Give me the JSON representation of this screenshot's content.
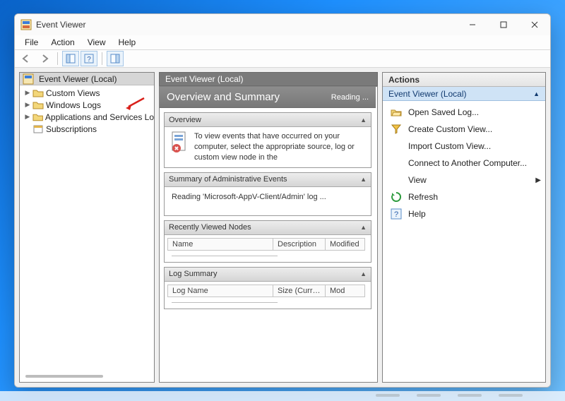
{
  "window": {
    "title": "Event Viewer"
  },
  "menu": {
    "file": "File",
    "action": "Action",
    "view": "View",
    "help": "Help"
  },
  "tree": {
    "root": "Event Viewer (Local)",
    "items": [
      {
        "label": "Custom Views",
        "expandable": true
      },
      {
        "label": "Windows Logs",
        "expandable": true,
        "arrow": true
      },
      {
        "label": "Applications and Services Lo",
        "expandable": true
      },
      {
        "label": "Subscriptions",
        "expandable": false
      }
    ]
  },
  "center": {
    "header": "Event Viewer (Local)",
    "title": "Overview and Summary",
    "reading": "Reading ...",
    "overview": {
      "label": "Overview",
      "text": "To view events that have occurred on your computer, select the appropriate source, log or custom view node in the"
    },
    "summary": {
      "label": "Summary of Administrative Events",
      "text": "Reading 'Microsoft-AppV-Client/Admin' log ..."
    },
    "recent": {
      "label": "Recently Viewed Nodes",
      "cols": {
        "c1": "Name",
        "c2": "Description",
        "c3": "Modified"
      }
    },
    "logsum": {
      "label": "Log Summary",
      "cols": {
        "c1": "Log Name",
        "c2": "Size (Curr…",
        "c3": "Mod"
      }
    }
  },
  "actions": {
    "header": "Actions",
    "scope": "Event Viewer (Local)",
    "items": {
      "open_saved": "Open Saved Log...",
      "create_view": "Create Custom View...",
      "import_view": "Import Custom View...",
      "connect": "Connect to Another Computer...",
      "view": "View",
      "refresh": "Refresh",
      "help": "Help"
    }
  }
}
